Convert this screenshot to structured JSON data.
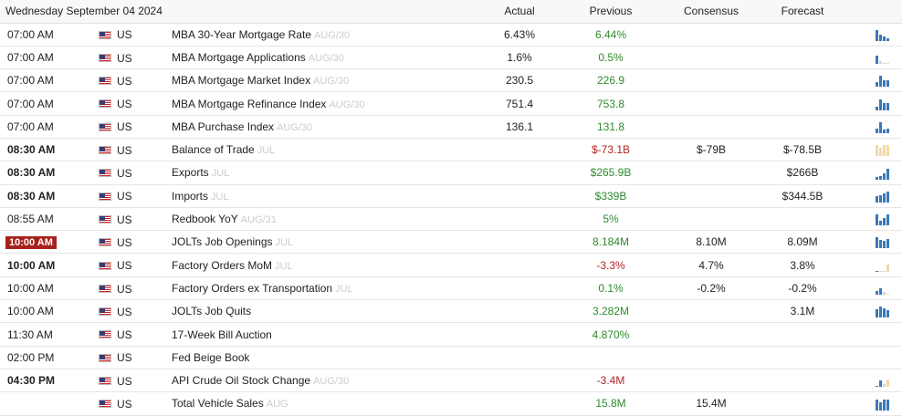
{
  "header": {
    "date": "Wednesday September 04 2024",
    "actual": "Actual",
    "previous": "Previous",
    "consensus": "Consensus",
    "forecast": "Forecast"
  },
  "colors": {
    "positive": "#2f8a2f",
    "negative": "#b32424",
    "bar_blue": "#3a79b8",
    "bar_light": "#c8d9ea",
    "bar_tan": "#f2d9a8"
  },
  "rows": [
    {
      "time": "07:00 AM",
      "bold": false,
      "highlight": false,
      "country": "US",
      "event": "MBA 30-Year Mortgage Rate",
      "ref": "AUG/30",
      "actual": "6.43%",
      "previous": "6.44%",
      "previous_color": "pos",
      "consensus": "",
      "forecast": "",
      "spark": {
        "color": "blue",
        "levels": [
          0.9,
          0.5,
          0.4,
          0.2
        ]
      }
    },
    {
      "time": "07:00 AM",
      "bold": false,
      "highlight": false,
      "country": "US",
      "event": "MBA Mortgage Applications",
      "ref": "AUG/30",
      "actual": "1.6%",
      "previous": "0.5%",
      "previous_color": "pos",
      "consensus": "",
      "forecast": "",
      "spark": {
        "color": "mixed",
        "levels": [
          0.7,
          0.2,
          0.1,
          0.1
        ]
      }
    },
    {
      "time": "07:00 AM",
      "bold": false,
      "highlight": false,
      "country": "US",
      "event": "MBA Mortgage Market Index",
      "ref": "AUG/30",
      "actual": "230.5",
      "previous": "226.9",
      "previous_color": "pos",
      "consensus": "",
      "forecast": "",
      "spark": {
        "color": "blue",
        "levels": [
          0.4,
          0.9,
          0.5,
          0.5
        ]
      }
    },
    {
      "time": "07:00 AM",
      "bold": false,
      "highlight": false,
      "country": "US",
      "event": "MBA Mortgage Refinance Index",
      "ref": "AUG/30",
      "actual": "751.4",
      "previous": "753.8",
      "previous_color": "pos",
      "consensus": "",
      "forecast": "",
      "spark": {
        "color": "blue",
        "levels": [
          0.3,
          0.9,
          0.6,
          0.6
        ]
      }
    },
    {
      "time": "07:00 AM",
      "bold": false,
      "highlight": false,
      "country": "US",
      "event": "MBA Purchase Index",
      "ref": "AUG/30",
      "actual": "136.1",
      "previous": "131.8",
      "previous_color": "pos",
      "consensus": "",
      "forecast": "",
      "spark": {
        "color": "blue",
        "levels": [
          0.4,
          0.9,
          0.3,
          0.4
        ]
      }
    },
    {
      "time": "08:30 AM",
      "bold": true,
      "highlight": false,
      "country": "US",
      "event": "Balance of Trade",
      "ref": "JUL",
      "actual": "",
      "previous": "$-73.1B",
      "previous_color": "neg",
      "consensus": "$-79B",
      "forecast": "$-78.5B",
      "spark": {
        "color": "tan",
        "levels": [
          0.9,
          0.7,
          0.9,
          0.9
        ]
      }
    },
    {
      "time": "08:30 AM",
      "bold": true,
      "highlight": false,
      "country": "US",
      "event": "Exports",
      "ref": "JUL",
      "actual": "",
      "previous": "$265.9B",
      "previous_color": "pos",
      "consensus": "",
      "forecast": "$266B",
      "spark": {
        "color": "blue",
        "levels": [
          0.2,
          0.3,
          0.5,
          0.9
        ]
      }
    },
    {
      "time": "08:30 AM",
      "bold": true,
      "highlight": false,
      "country": "US",
      "event": "Imports",
      "ref": "JUL",
      "actual": "",
      "previous": "$339B",
      "previous_color": "pos",
      "consensus": "",
      "forecast": "$344.5B",
      "spark": {
        "color": "blue",
        "levels": [
          0.5,
          0.6,
          0.8,
          0.9
        ]
      }
    },
    {
      "time": "08:55 AM",
      "bold": false,
      "highlight": false,
      "country": "US",
      "event": "Redbook YoY",
      "ref": "AUG/31",
      "actual": "",
      "previous": "5%",
      "previous_color": "pos",
      "consensus": "",
      "forecast": "",
      "spark": {
        "color": "blue",
        "levels": [
          0.9,
          0.4,
          0.6,
          0.9
        ]
      }
    },
    {
      "time": "10:00 AM",
      "bold": true,
      "highlight": true,
      "country": "US",
      "event": "JOLTs Job Openings",
      "ref": "JUL",
      "actual": "",
      "previous": "8.184M",
      "previous_color": "pos",
      "consensus": "8.10M",
      "forecast": "8.09M",
      "spark": {
        "color": "blue",
        "levels": [
          0.9,
          0.7,
          0.6,
          0.8
        ]
      }
    },
    {
      "time": "10:00 AM",
      "bold": true,
      "highlight": false,
      "country": "US",
      "event": "Factory Orders MoM",
      "ref": "JUL",
      "actual": "",
      "previous": "-3.3%",
      "previous_color": "neg",
      "consensus": "4.7%",
      "forecast": "3.8%",
      "spark": {
        "color": "mixed",
        "levels": [
          0.1,
          0.1,
          0.1,
          0.6
        ]
      }
    },
    {
      "time": "10:00 AM",
      "bold": false,
      "highlight": false,
      "country": "US",
      "event": "Factory Orders ex Transportation",
      "ref": "JUL",
      "actual": "",
      "previous": "0.1%",
      "previous_color": "pos",
      "consensus": "-0.2%",
      "forecast": "-0.2%",
      "spark": {
        "color": "mixed",
        "levels": [
          0.3,
          0.5,
          0.2,
          0.1
        ]
      }
    },
    {
      "time": "10:00 AM",
      "bold": false,
      "highlight": false,
      "country": "US",
      "event": "JOLTs Job Quits",
      "ref": "",
      "actual": "",
      "previous": "3.282M",
      "previous_color": "pos",
      "consensus": "",
      "forecast": "3.1M",
      "spark": {
        "color": "blue",
        "levels": [
          0.7,
          0.9,
          0.8,
          0.6
        ]
      }
    },
    {
      "time": "11:30 AM",
      "bold": false,
      "highlight": false,
      "country": "US",
      "event": "17-Week Bill Auction",
      "ref": "",
      "actual": "",
      "previous": "4.870%",
      "previous_color": "pos",
      "consensus": "",
      "forecast": "",
      "spark": null
    },
    {
      "time": "02:00 PM",
      "bold": false,
      "highlight": false,
      "country": "US",
      "event": "Fed Beige Book",
      "ref": "",
      "actual": "",
      "previous": "",
      "previous_color": "pos",
      "consensus": "",
      "forecast": "",
      "spark": null
    },
    {
      "time": "04:30 PM",
      "bold": true,
      "highlight": false,
      "country": "US",
      "event": "API Crude Oil Stock Change",
      "ref": "AUG/30",
      "actual": "",
      "previous": "-3.4M",
      "previous_color": "neg",
      "consensus": "",
      "forecast": "",
      "spark": {
        "color": "mixed",
        "levels": [
          0.1,
          0.5,
          0.2,
          0.6
        ]
      }
    },
    {
      "time": "",
      "bold": false,
      "highlight": false,
      "country": "US",
      "event": "Total Vehicle Sales",
      "ref": "AUG",
      "actual": "",
      "previous": "15.8M",
      "previous_color": "pos",
      "consensus": "15.4M",
      "forecast": "",
      "spark": {
        "color": "blue",
        "levels": [
          0.9,
          0.7,
          0.9,
          0.9
        ]
      }
    }
  ]
}
